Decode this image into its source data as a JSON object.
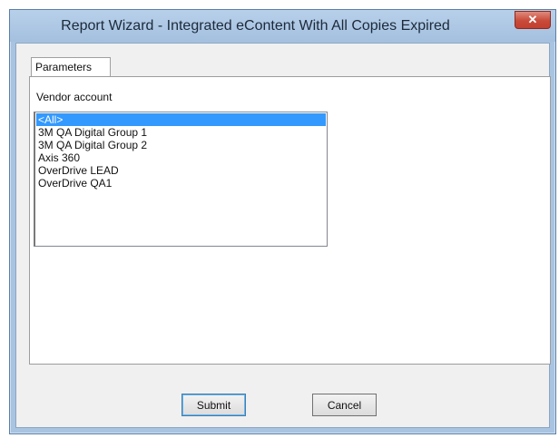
{
  "window": {
    "title": "Report Wizard - Integrated eContent With All Copies Expired",
    "close_icon": "close-x-icon"
  },
  "tabs": [
    {
      "label": "Parameters",
      "active": true
    }
  ],
  "form": {
    "vendor_label": "Vendor account",
    "vendor_options": [
      "<All>",
      "3M QA Digital Group 1",
      "3M QA Digital Group 2",
      "Axis 360",
      "OverDrive LEAD",
      "OverDrive QA1"
    ],
    "selected_index": 0
  },
  "buttons": {
    "submit_label": "Submit",
    "cancel_label": "Cancel"
  },
  "colors": {
    "selection": "#3399ff",
    "close_button": "#c84a39",
    "title_bar": "#a9c4e0"
  }
}
